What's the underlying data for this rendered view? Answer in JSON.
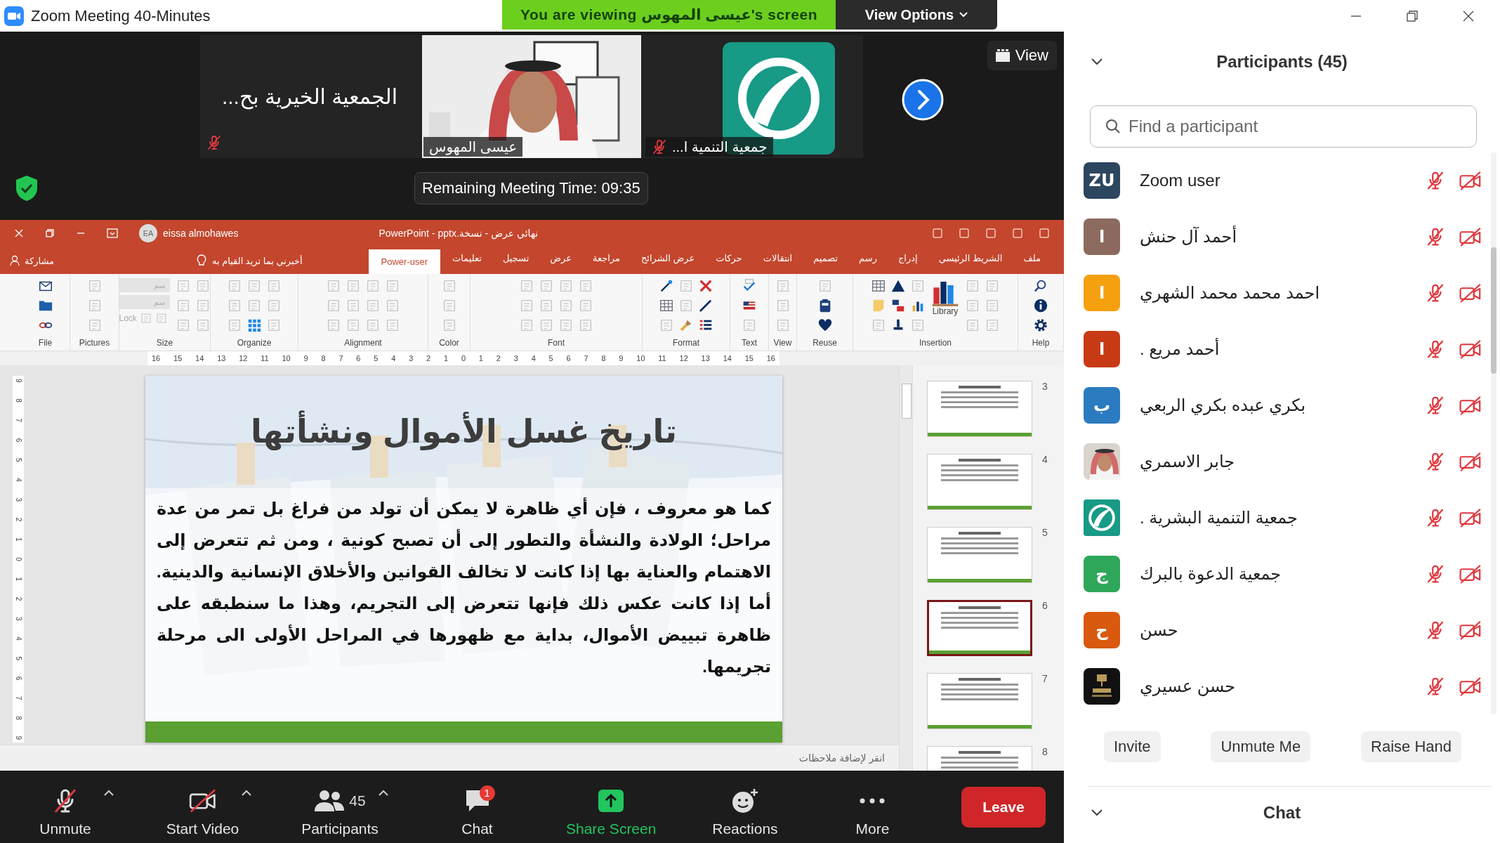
{
  "window": {
    "title": "Zoom Meeting 40-Minutes"
  },
  "share_banner": "You are viewing عيسى المهوس's screen",
  "view_options": "View Options",
  "video_strip": {
    "tiles": [
      {
        "kind": "logo",
        "name": "جمعية التنمية ا...",
        "muted": true
      },
      {
        "kind": "video",
        "name": "عيسى المهوس",
        "muted": false
      },
      {
        "kind": "name",
        "name": "الجمعية الخيرية بح...",
        "muted": true
      }
    ],
    "view_button": "View"
  },
  "remaining_time": "Remaining Meeting Time: 09:35",
  "powerpoint": {
    "user": {
      "initials": "EA",
      "name": "eissa almohawes"
    },
    "title": "PowerPoint - pptx.نهائي عرض - نسخة",
    "share": "مشاركة",
    "tell_me": "أخبرني بما تريد القيام به",
    "tabs": [
      {
        "label": "ملف",
        "selected": false
      },
      {
        "label": "الشريط الرئيسي",
        "selected": false
      },
      {
        "label": "إدراج",
        "selected": false
      },
      {
        "label": "رسم",
        "selected": false
      },
      {
        "label": "تصميم",
        "selected": false
      },
      {
        "label": "انتقالات",
        "selected": false
      },
      {
        "label": "حركات",
        "selected": false
      },
      {
        "label": "عرض الشرائح",
        "selected": false
      },
      {
        "label": "مراجعة",
        "selected": false
      },
      {
        "label": "عرض",
        "selected": false
      },
      {
        "label": "تسجيل",
        "selected": false
      },
      {
        "label": "تعليمات",
        "selected": false
      },
      {
        "label": "Power-user",
        "selected": true
      }
    ],
    "ribbon_groups": [
      {
        "label": "Help"
      },
      {
        "label": "Insertion",
        "library_label": "Library"
      },
      {
        "label": "Reuse"
      },
      {
        "label": "View"
      },
      {
        "label": "Text"
      },
      {
        "label": "Format"
      },
      {
        "label": "Font"
      },
      {
        "label": "Color"
      },
      {
        "label": "Alignment"
      },
      {
        "label": "Organize"
      },
      {
        "label": "Size",
        "inputs": [
          {
            "value": "سم",
            "disabled": true
          },
          {
            "value": "سم",
            "disabled": true
          }
        ],
        "lock_label": "Lock"
      },
      {
        "label": "Pictures"
      },
      {
        "label": "File"
      }
    ],
    "ruler_h": "16 15 14 13 12 11 10 9 8 7 6 5 4 3 2 1 0 1 2 3 4 5 6 7 8 9 10 11 12 13 14 15 16",
    "ruler_v": "9 8 7 6 5 4 3 2 1 0 1 2 3 4 5 6 7 8 9",
    "slide": {
      "title": "تاريخ غسل الأموال ونشأتها",
      "body": "كما هو معروف ، فإن أي ظاهرة لا يمكن أن تولد من فراغ بل تمر من عدة مراحل؛ الولادة والنشأة والتطور إلى أن تصبح كونية ، ومن ثم تتعرض إلى الاهتمام والعناية بها إذا كانت لا تخالف القوانين والأخلاق الإنسانية والدينية. أما إذا كانت عكس ذلك فإنها تتعرض إلى التجريم، وهذا ما سنطبقه على ظاهرة تبييض الأموال، بداية مع ظهورها في المراحل الأولى الى مرحلة تجريمها."
    },
    "thumbnails": [
      {
        "number": "3",
        "selected": false
      },
      {
        "number": "4",
        "selected": false
      },
      {
        "number": "5",
        "selected": false
      },
      {
        "number": "6",
        "selected": true
      },
      {
        "number": "7",
        "selected": false
      },
      {
        "number": "8",
        "selected": false
      }
    ],
    "notes_placeholder": "انقر لإضافة ملاحظات"
  },
  "toolbar": {
    "items": [
      {
        "kind": "more",
        "label": "More",
        "menu": false
      },
      {
        "kind": "reactions",
        "label": "Reactions",
        "menu": false
      },
      {
        "kind": "share",
        "label": "Share Screen",
        "menu": false
      },
      {
        "kind": "chat",
        "label": "Chat",
        "badge": "1",
        "menu": false
      },
      {
        "kind": "participants",
        "label": "Participants",
        "count": "45",
        "menu": true
      },
      {
        "kind": "camera",
        "label": "Start Video",
        "off": true,
        "menu": true
      },
      {
        "kind": "mic",
        "label": "Unmute",
        "off": true,
        "menu": true
      }
    ],
    "leave": "Leave"
  },
  "participants": {
    "title": "Participants (45)",
    "search": {
      "placeholder": "Find a participant"
    },
    "items": [
      {
        "name": "Zoom user",
        "avatar": {
          "kind": "initials",
          "initials": "ZU",
          "color": "#2d4660"
        },
        "muted": true,
        "video_off": true
      },
      {
        "name": "أحمد آل حنش",
        "avatar": {
          "kind": "initials",
          "initials": "ا",
          "color": "#8c6a5f"
        },
        "muted": true,
        "video_off": true
      },
      {
        "name": "احمد محمد محمد الشهري",
        "avatar": {
          "kind": "initials",
          "initials": "ا",
          "color": "#f5a00f"
        },
        "muted": true,
        "video_off": true
      },
      {
        "name": "أحمد مريع .",
        "avatar": {
          "kind": "initials",
          "initials": "ا",
          "color": "#c83a16"
        },
        "muted": true,
        "video_off": true
      },
      {
        "name": "بكري عبده بكري الربعي",
        "avatar": {
          "kind": "initials",
          "initials": "ب",
          "color": "#2b7bc0"
        },
        "muted": true,
        "video_off": true
      },
      {
        "name": "جابر الاسمري",
        "muted": true,
        "video_off": true
      },
      {
        "name": "جمعية التنمية البشرية .",
        "avatar": {
          "kind": "logo"
        },
        "muted": true,
        "video_off": true
      },
      {
        "name": "جمعية الدعوة بالبرك",
        "avatar": {
          "kind": "initials",
          "initials": "ج",
          "color": "#2fa75a"
        },
        "muted": true,
        "video_off": true
      },
      {
        "name": "حسن",
        "avatar": {
          "kind": "initials",
          "initials": "ح",
          "color": "#d9590f"
        },
        "muted": true,
        "video_off": true
      },
      {
        "name": "حسن عسيري",
        "avatar": {
          "kind": "emblem"
        },
        "muted": true,
        "video_off": true
      }
    ],
    "buttons": [
      "Raise Hand",
      "Unmute Me",
      "Invite"
    ],
    "chat_title": "Chat"
  }
}
